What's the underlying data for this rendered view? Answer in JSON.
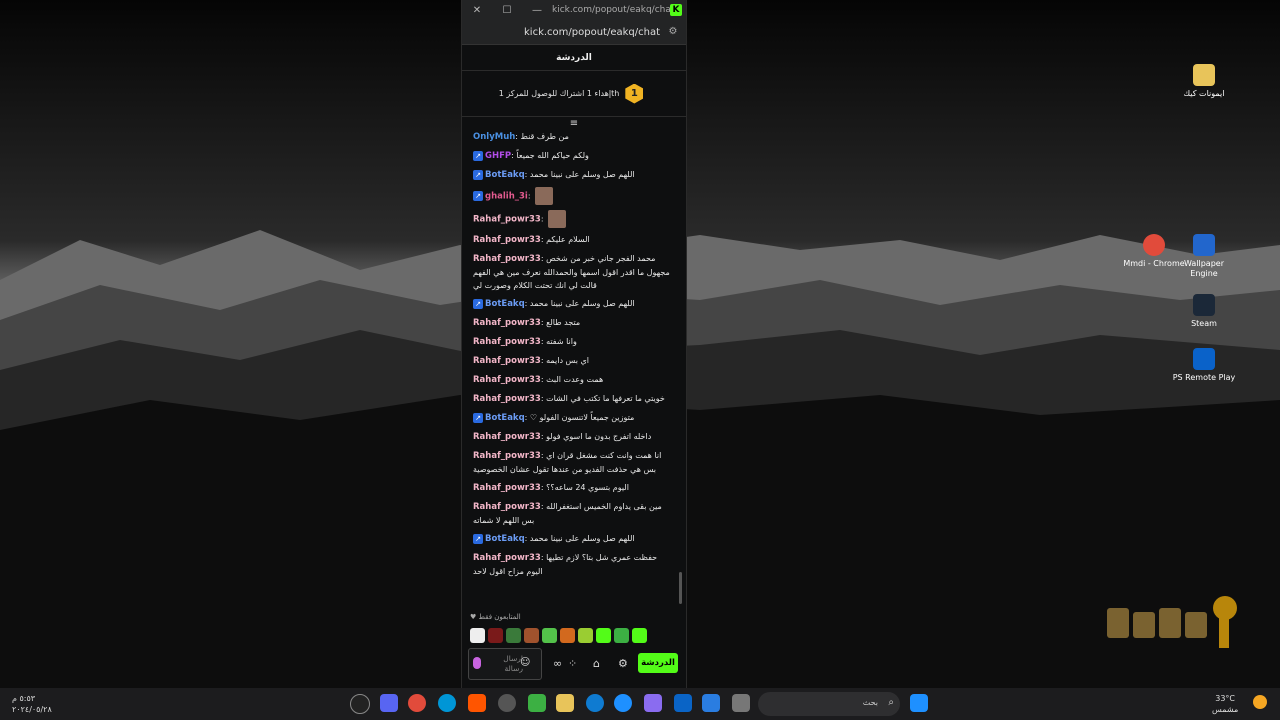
{
  "browser": {
    "tab_title": "kick.com/popout/eakq/chat -...",
    "address": "kick.com/popout/eakq/chat",
    "close_glyph": "✕",
    "maximize_glyph": "☐",
    "minimize_glyph": "—"
  },
  "chat": {
    "header": "الدردشة",
    "pinned_badge": "1",
    "pinned_text": "إهداء 1 اشتراك للوصول للمركز 1th",
    "collapse_glyph": "≡",
    "messages": [
      {
        "user": "OnlyMuh",
        "text": "من طرف قنط",
        "color": "#4a90e2",
        "bot": false
      },
      {
        "user": "GHFP",
        "text": "ولكم حياكم الله جميعاً",
        "color": "#b24de8",
        "bot": true
      },
      {
        "user": "BotEakq",
        "text": "اللهم صل وسلم على نبينا محمد",
        "color": "#6b9cf5",
        "bot": true
      },
      {
        "user": "ghalih_3i",
        "text": "",
        "color": "#e35b8f",
        "bot": true,
        "emote": true
      },
      {
        "user": "Rahaf_powr33",
        "text": "",
        "color": "#f2b6c8",
        "bot": false,
        "emote": true
      },
      {
        "user": "Rahaf_powr33",
        "text": "السلام عليكم",
        "color": "#f2b6c8",
        "bot": false
      },
      {
        "user": "Rahaf_powr33",
        "text": "محمد الفجر جاني خبر من شخص مجهول ما اقدر اقول اسمها والحمدالله نعرف مين هي الفهم قالت لي انك تحتت الكلام وصورت لي",
        "color": "#f2b6c8",
        "bot": false
      },
      {
        "user": "BotEakq",
        "text": "اللهم صل وسلم على نبينا محمد",
        "color": "#6b9cf5",
        "bot": true
      },
      {
        "user": "Rahaf_powr33",
        "text": "متجد طالع",
        "color": "#f2b6c8",
        "bot": false
      },
      {
        "user": "Rahaf_powr33",
        "text": "وانا شفته",
        "color": "#f2b6c8",
        "bot": false
      },
      {
        "user": "Rahaf_powr33",
        "text": "اي بس دايمه",
        "color": "#f2b6c8",
        "bot": false
      },
      {
        "user": "Rahaf_powr33",
        "text": "همت وعدت البث",
        "color": "#f2b6c8",
        "bot": false
      },
      {
        "user": "Rahaf_powr33",
        "text": "خويتي ما تعرفها ما تكتب في الشات",
        "color": "#f2b6c8",
        "bot": false
      },
      {
        "user": "BotEakq",
        "text": "♡ متوزين جميعاً لاتنسون الفولو",
        "color": "#6b9cf5",
        "bot": true
      },
      {
        "user": "Rahaf_powr33",
        "text": "داخله اتفرج بدون ما اسوي فولو",
        "color": "#f2b6c8",
        "bot": false
      },
      {
        "user": "Rahaf_powr33",
        "text": "انا همت وانت كنت مشغل قران اي بس هي حذفت الفديو من عندها تقول عشان الخصوصية",
        "color": "#f2b6c8",
        "bot": false
      },
      {
        "user": "Rahaf_powr33",
        "text": "اليوم بتسوي 24 ساعه؟؟",
        "color": "#f2b6c8",
        "bot": false
      },
      {
        "user": "Rahaf_powr33",
        "text": "مين بقى يداوم الخميس استغفرالله بس اللهم لا شماته",
        "color": "#f2b6c8",
        "bot": false
      },
      {
        "user": "BotEakq",
        "text": "اللهم صل وسلم على نبينا محمد",
        "color": "#6b9cf5",
        "bot": true
      },
      {
        "user": "Rahaf_powr33",
        "text": "حفظت عمري شل بتا؟ لازم تطيها اليوم مزاح اقول لاحد",
        "color": "#f2b6c8",
        "bot": false
      }
    ],
    "subs_label": "المتابعون فقط",
    "input_placeholder": "إرسال رسالة",
    "send_label": "الدردشة",
    "accent": "#53fc18"
  },
  "desktop_icons": [
    {
      "label": "ايمونات كيك",
      "icon": "folder-icon"
    },
    {
      "label": "Wallpaper Engine",
      "icon": "wallpaper-engine-icon"
    },
    {
      "label": "Mmdi - Chrome",
      "icon": "chrome-icon"
    },
    {
      "label": "Steam",
      "icon": "steam-icon"
    },
    {
      "label": "PS Remote Play",
      "icon": "ps-remote-play-icon"
    }
  ],
  "taskbar": {
    "search_label": "بحث",
    "time": "٥:٥٣ م",
    "date": "٢٠٢٤/٠٥/٢٨",
    "temperature": "33°C",
    "weather": "مشمس"
  }
}
